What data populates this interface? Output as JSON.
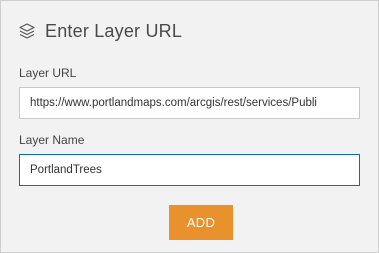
{
  "header": {
    "icon": "layers-icon",
    "title": "Enter Layer URL"
  },
  "form": {
    "url_label": "Layer URL",
    "url_value": "https://www.portlandmaps.com/arcgis/rest/services/Publi",
    "name_label": "Layer Name",
    "name_value": "PortlandTrees"
  },
  "actions": {
    "add_label": "ADD"
  },
  "colors": {
    "panel_bg": "#f2f2f2",
    "accent_button": "#e8912d",
    "focus_border": "#0b72a8"
  }
}
